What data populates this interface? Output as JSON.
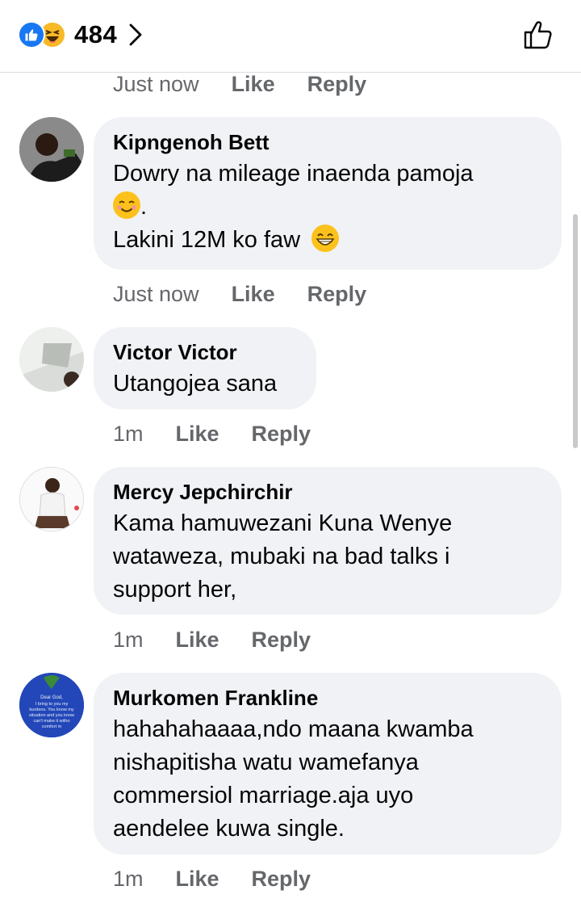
{
  "header": {
    "reaction_count": "484",
    "reaction_icons": [
      "like-icon",
      "haha-icon"
    ],
    "chevron_icon": "chevron-right-icon",
    "like_icon": "thumbs-up-outline-icon"
  },
  "top_meta": {
    "time": "Just now",
    "like": "Like",
    "reply": "Reply"
  },
  "comments": [
    {
      "author": "Kipngenoh Bett",
      "line1": "Dowry na mileage inaenda pamoja",
      "line2_suffix": ".",
      "line3": "Lakini 12M ko faw",
      "emojis": [
        "smiling-face-icon",
        "grinning-face-icon"
      ],
      "time": "Just now",
      "like": "Like",
      "reply": "Reply"
    },
    {
      "author": "Victor Victor",
      "text": "Utangojea sana",
      "time": "1m",
      "like": "Like",
      "reply": "Reply"
    },
    {
      "author": "Mercy Jepchirchir",
      "lines": [
        "Kama hamuwezani Kuna Wenye",
        "wataweza, mubaki na bad talks i",
        "support her,"
      ],
      "time": "1m",
      "like": "Like",
      "reply": "Reply"
    },
    {
      "author": "Murkomen Frankline",
      "lines": [
        "hahahahaaaa,ndo maana kwamba",
        "nishapitisha watu wamefanya",
        "commersiol marriage.aja uyo",
        "aendelee kuwa single."
      ],
      "avatar_text": [
        "Dear God,",
        "I bring to you my",
        "burdens. You know my",
        "situation and you know",
        "can't make it witho",
        "comfort m"
      ],
      "time": "1m",
      "like": "Like",
      "reply": "Reply"
    }
  ],
  "colors": {
    "accent": "#1877f2",
    "bubble": "#f0f2f5",
    "meta": "#65676b"
  }
}
